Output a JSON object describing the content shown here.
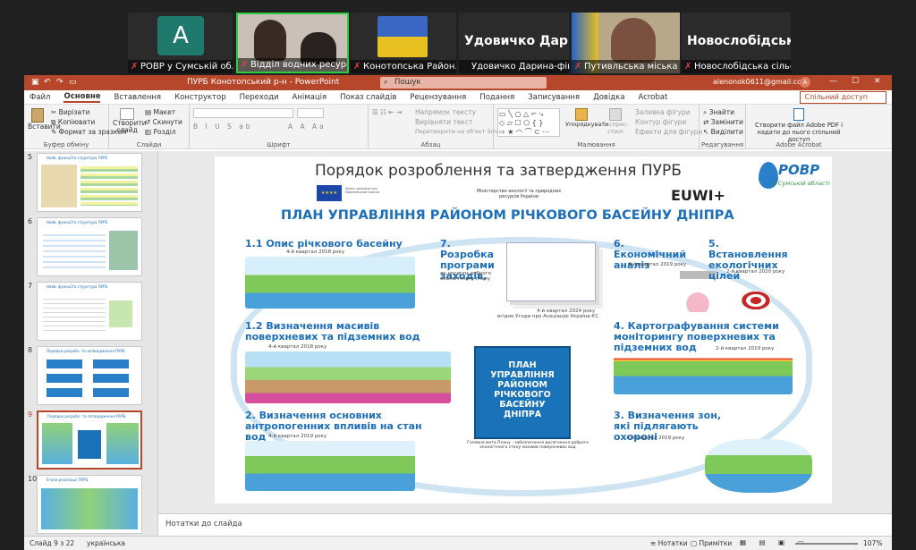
{
  "meeting": {
    "participants": [
      {
        "caption": "РОВР у Сумській обла...",
        "avatar_letter": "A",
        "avatar_color": "#1f7a6d"
      },
      {
        "caption": "Відділ водних ресурсів Р..."
      },
      {
        "caption": "Конотопська Район..."
      },
      {
        "caption": "Удовичко Дарина-фінанс...",
        "big_name": "Удовичко Дари..."
      },
      {
        "caption": "Путивльська міська р..."
      },
      {
        "caption": "Новослобідська сільс...",
        "big_name": "Новослобідськ..."
      }
    ]
  },
  "titlebar": {
    "doc_title": "ПУРБ Конотопський р-н  -  PowerPoint",
    "search_placeholder": "Пошук",
    "account": "alenonok0611@gmail.com",
    "account_initial": "A",
    "share": "Спільний доступ"
  },
  "tabs": [
    "Файл",
    "Основне",
    "Вставлення",
    "Конструктор",
    "Переходи",
    "Анімація",
    "Показ слайдів",
    "Рецензування",
    "Подання",
    "Записування",
    "Довідка",
    "Acrobat"
  ],
  "active_tab": "Основне",
  "ribbon": {
    "paste": "Вставити",
    "cut": "Вирізати",
    "copy": "Копіювати",
    "format_painter": "Формат за зразком",
    "clipboard_label": "Буфер обміну",
    "new_slide": "Створити слайд",
    "layout": "Макет",
    "reset": "Скинути",
    "section": "Розділ",
    "slides_label": "Слайди",
    "font_label": "Шрифт",
    "text_direction": "Напрямок тексту",
    "align_text": "Вирівняти текст",
    "convert_smartart": "Перетворити на об'єкт SmartArt",
    "paragraph_label": "Абзац",
    "arrange": "Упорядкувати",
    "quick_styles": "Експрес-стилі",
    "shape_fill": "Заливка фігури",
    "shape_outline": "Контур фігури",
    "shape_effects": "Ефекти для фігури",
    "drawing_label": "Малювання",
    "find": "Знайти",
    "replace": "Замінити",
    "select": "Виділити",
    "editing_label": "Редагування",
    "adobe_create": "Створити файл Adobe PDF і",
    "adobe_share": "надати до нього спільний доступ",
    "adobe_label": "Adobe Acrobat"
  },
  "thumbnails": [
    {
      "num": "5",
      "title": "Найв. функціїта структура ПУРБ"
    },
    {
      "num": "6",
      "title": "Найв. функціїта структура ПУРБ"
    },
    {
      "num": "7",
      "title": "Найв. функціїта структура ПУРБ"
    },
    {
      "num": "8",
      "title": "Порядок розробл. та затвердження ПУРБ"
    },
    {
      "num": "9",
      "title": "Порядок розробл. та затвердження ПУРБ"
    },
    {
      "num": "10",
      "title": "Етапи реалізації ПУРБ"
    }
  ],
  "selected_slide": "9",
  "slide": {
    "title": "Порядок розроблення та затвердження ПУРБ",
    "logo_main": "РОВР",
    "logo_sub": "у Сумській області",
    "eu_caption": "Проєкт фінансується Європейським Союзом",
    "ministry": "Міністерство екології та природних ресурсів України",
    "euwi": "EUWI+",
    "plan_title": "ПЛАН УПРАВЛІННЯ РАЙОНОМ РІЧКОВОГО БАСЕЙНУ ДНІПРА",
    "center_book": "ПЛАН УПРАВЛІННЯ РАЙОНОМ РІЧКОВОГО БАСЕЙНУ ДНІПРА",
    "center_caption": "Головна мета Плану - забезпечення досягнення доброго екологічного стану масивів поверхневих вод",
    "steps": [
      {
        "title": "1.1 Опис річкового басейну",
        "date": "4-й квартал 2018 року"
      },
      {
        "title": "1.2 Визначення масивів поверхневих та підземних вод",
        "date": "4-й квартал 2018 року"
      },
      {
        "title": "2. Визначення основних антропогенних впливів на стан вод",
        "date": "4-й квартал 2019 року"
      },
      {
        "title": "7. Розробка програми заходів,",
        "date": "як досягти доброго екологічного стану"
      },
      {
        "title": "6. Економічний аналіз",
        "date": "4-й квартал 2019 року"
      },
      {
        "title": "5. Встановлення екологічних цілей",
        "date": "2-й квартал 2020 року"
      },
      {
        "title": "4. Картографування системи моніторингу поверхневих та підземних вод",
        "date": "2-й квартал 2019 року"
      },
      {
        "title": "3. Визначення зон, які підлягають охороні",
        "date": "4-й квартал 2019 року"
      }
    ],
    "step7_date": "4-й квартал 2024 року",
    "step7_footer": "вгідно Угоди про Асоціацію Україна-ЄС"
  },
  "notes_placeholder": "Нотатки до слайда",
  "status": {
    "slide_counter": "Слайд 9 з 22",
    "language": "українська",
    "notes": "Нотатки",
    "comments": "Примітки",
    "zoom": "107%"
  },
  "colors": {
    "ppt_accent": "#b7472a",
    "slide_blue": "#1d6fb8",
    "book_blue": "#1a73b8"
  }
}
